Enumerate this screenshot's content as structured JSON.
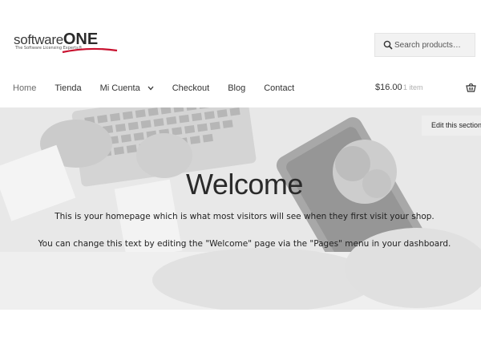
{
  "brand": {
    "logo_text_main": "software",
    "logo_text_one": "ONE",
    "tagline": "The Software Licensing Experts®",
    "accent_color": "#c8102e"
  },
  "search": {
    "placeholder": "Search products…",
    "icon": "search-icon"
  },
  "nav": {
    "items": [
      {
        "label": "Home",
        "active": true
      },
      {
        "label": "Tienda"
      },
      {
        "label": "Mi Cuenta",
        "has_dropdown": true
      },
      {
        "label": "Checkout"
      },
      {
        "label": "Blog"
      },
      {
        "label": "Contact"
      }
    ]
  },
  "cart": {
    "amount": "$16.00",
    "count": "1 item",
    "icon": "basket-icon"
  },
  "hero": {
    "edit_button": "Edit this section",
    "title": "Welcome",
    "paragraph_1": "This is your homepage which is what most visitors will see when they first visit your shop.",
    "paragraph_2": "You can change this text by editing the \"Welcome\" page via the \"Pages\" menu in your dashboard."
  }
}
